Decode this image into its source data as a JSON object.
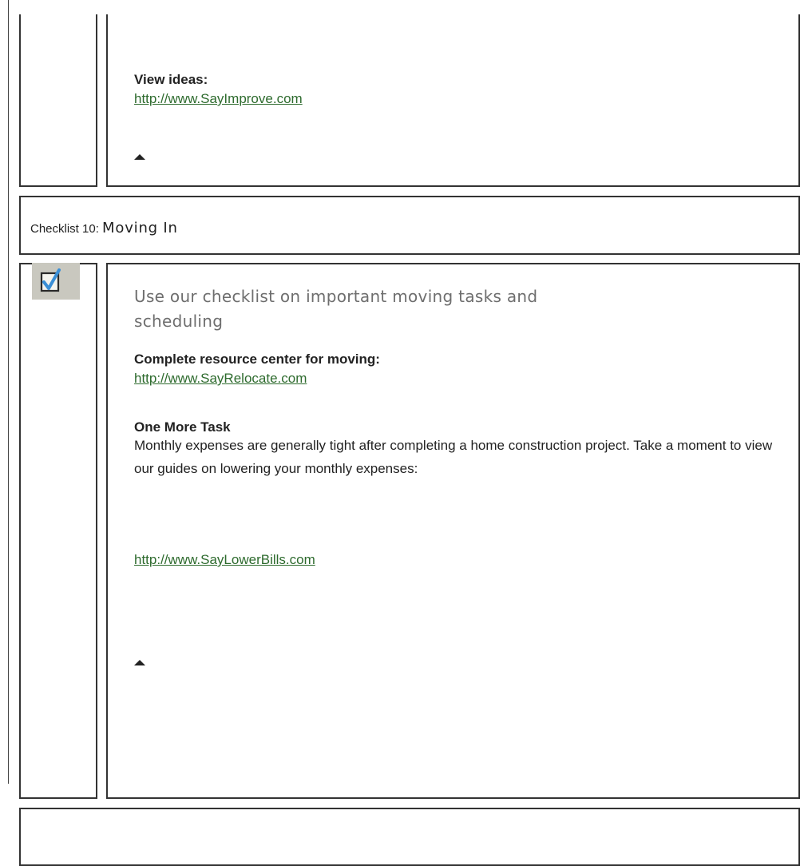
{
  "section_top": {
    "heading": "View ideas:",
    "link": "http://www.SayImprove.com"
  },
  "checklist": {
    "prefix": "Checklist 10: ",
    "title": "Moving In"
  },
  "section_main": {
    "lead": "Use our checklist on important moving tasks and scheduling",
    "resource_heading": "Complete resource center for moving:",
    "resource_link": "http://www.SayRelocate.com",
    "task_heading": "One More Task",
    "task_text": "Monthly expenses are generally tight after completing a home construction project. Take a moment to view our guides on lowering your monthly expenses:",
    "task_link": "http://www.SayLowerBills.com"
  },
  "icons": {
    "checkbox": "checked-checkbox-icon",
    "back_to_top": "up-arrow-icon"
  },
  "colors": {
    "link": "#2e6b2e",
    "border": "#333333",
    "lead_text": "#6e6e6e",
    "icon_bg": "#c9c8bf",
    "check_blue": "#3a8fd6"
  }
}
